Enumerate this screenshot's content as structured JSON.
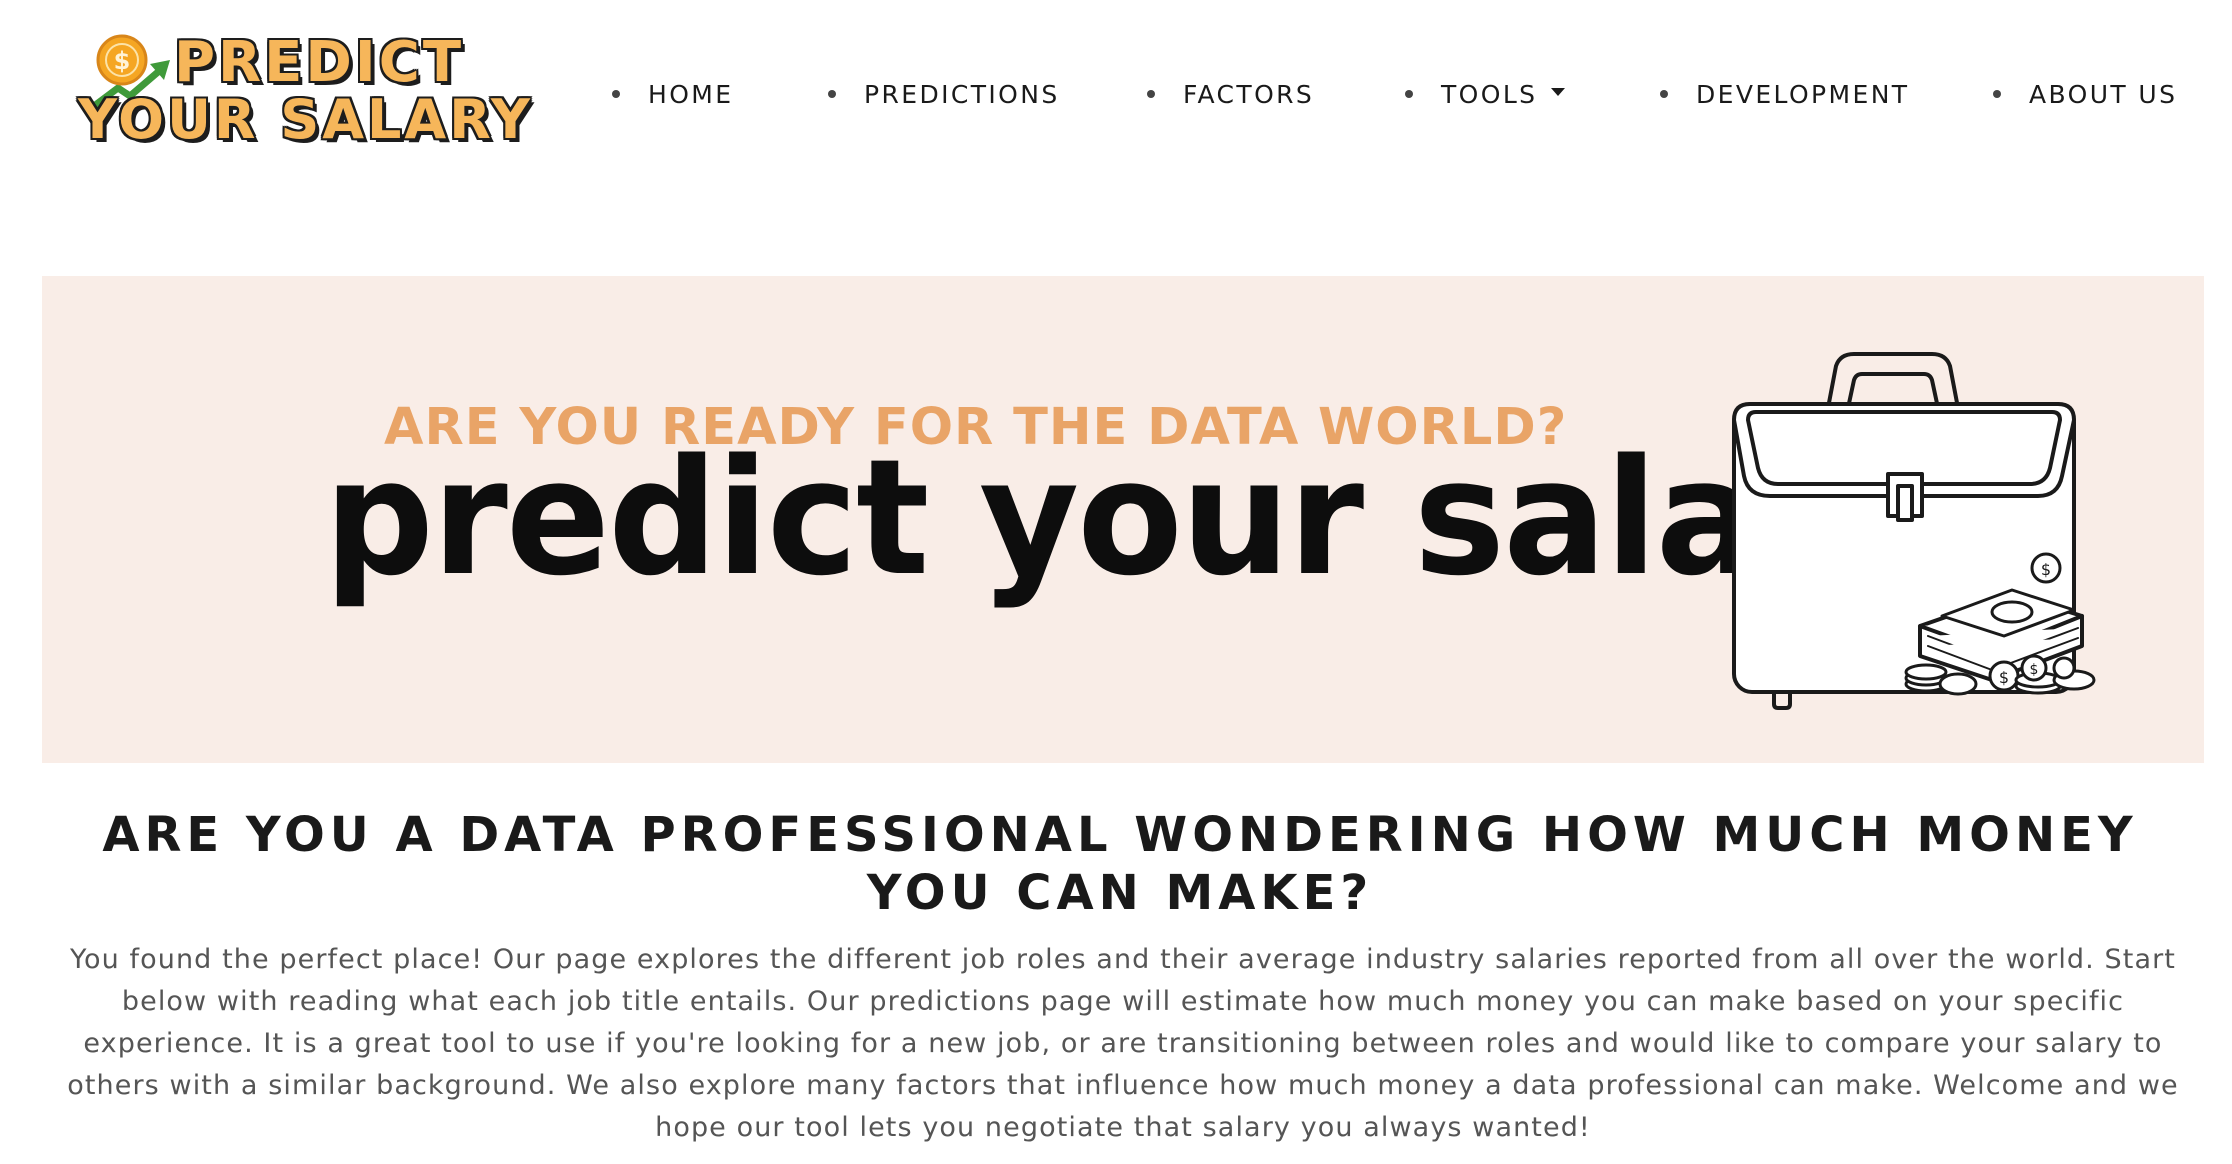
{
  "logo": {
    "line1": "PREDICT",
    "line2": "YOUR SALARY",
    "icons": [
      "dollar-coin-icon",
      "growth-arrow-icon"
    ]
  },
  "nav": {
    "items": [
      {
        "label": "HOME"
      },
      {
        "label": "PREDICTIONS"
      },
      {
        "label": "FACTORS"
      },
      {
        "label": "TOOLS",
        "has_dropdown": true
      },
      {
        "label": "DEVELOPMENT"
      },
      {
        "label": "ABOUT US"
      }
    ]
  },
  "hero": {
    "tagline": "ARE YOU READY FOR THE DATA WORLD?",
    "title": "predict your salary",
    "illustration": "briefcase-money-icon",
    "background": "#f9ede7",
    "tagline_color": "#e9a467"
  },
  "main": {
    "headline": "ARE YOU A DATA PROFESSIONAL WONDERING HOW MUCH MONEY YOU CAN MAKE?",
    "body": "You found the perfect place! Our page explores the different job roles and their average industry salaries reported from all over the world. Start below with reading what each job title entails. Our predictions page will estimate how much money you can make based on your specific experience. It is a great tool to use if you're looking for a new job, or are transitioning between roles and would like to compare your salary to others with a similar background. We also explore many factors that influence how much money a data professional can make. Welcome and we hope our tool lets you negotiate that salary you always wanted!"
  },
  "colors": {
    "logo_fill": "#f6b65a",
    "text_dark": "#1a1a1a",
    "body_text": "#555555"
  }
}
